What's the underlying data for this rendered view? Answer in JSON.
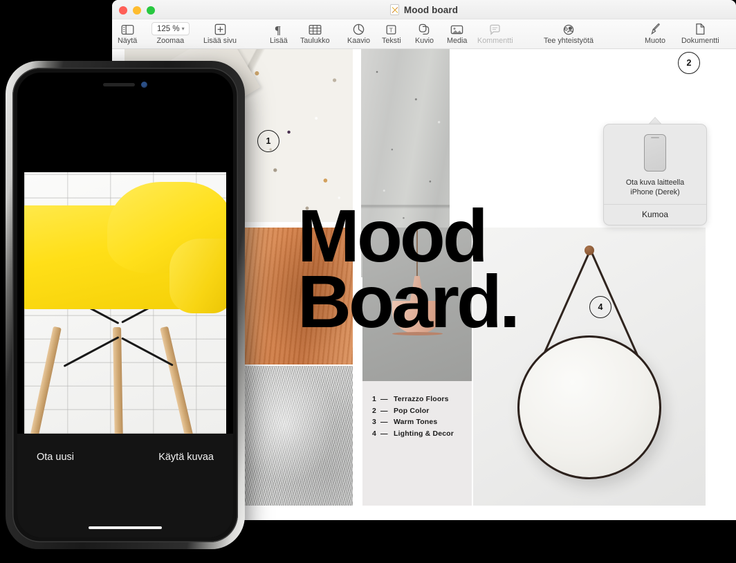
{
  "window": {
    "title": "Mood board",
    "document_icon": "keynote-document-icon",
    "traffic_lights": [
      "close-button",
      "minimize-button",
      "maximize-button"
    ]
  },
  "toolbar": {
    "items": [
      {
        "label": "Näytä",
        "icon": "sidebar-view-icon",
        "dimmed": false
      },
      {
        "label": "Zoomaa",
        "icon": "zoom-chevron-icon",
        "dimmed": false,
        "value": "125 %"
      },
      {
        "label": "Lisää sivu",
        "icon": "add-page-icon",
        "dimmed": false
      },
      {
        "label": "Lisää",
        "icon": "pilcrow-icon",
        "dimmed": false
      },
      {
        "label": "Taulukko",
        "icon": "table-icon",
        "dimmed": false
      },
      {
        "label": "Kaavio",
        "icon": "chart-pie-icon",
        "dimmed": false
      },
      {
        "label": "Teksti",
        "icon": "text-box-icon",
        "dimmed": false
      },
      {
        "label": "Kuvio",
        "icon": "shapes-icon",
        "dimmed": false
      },
      {
        "label": "Media",
        "icon": "media-photo-icon",
        "dimmed": false
      },
      {
        "label": "Kommentti",
        "icon": "comment-bubble-icon",
        "dimmed": true
      },
      {
        "label": "Tee yhteistyötä",
        "icon": "collaborate-icon",
        "dimmed": false
      },
      {
        "label": "Muoto",
        "icon": "format-brush-icon",
        "dimmed": false
      },
      {
        "label": "Dokumentti",
        "icon": "document-icon",
        "dimmed": false
      }
    ]
  },
  "popover": {
    "device_icon": "iphone-device-icon",
    "message_line1": "Ota kuva laitteella",
    "message_line2": "iPhone (Derek)",
    "cancel_label": "Kumoa"
  },
  "document": {
    "headline": "Mood\nBoard.",
    "callouts": [
      {
        "number": "1"
      },
      {
        "number": "2"
      },
      {
        "number": "4"
      }
    ],
    "legend": [
      {
        "num": "1",
        "dash": "—",
        "label": "Terrazzo Floors"
      },
      {
        "num": "2",
        "dash": "—",
        "label": "Pop Color"
      },
      {
        "num": "3",
        "dash": "—",
        "label": "Warm Tones"
      },
      {
        "num": "4",
        "dash": "—",
        "label": "Lighting & Decor"
      }
    ],
    "images": [
      {
        "name": "terrazzo-slab-photo"
      },
      {
        "name": "concrete-wall-photo"
      },
      {
        "name": "plaster-wall-with-tan-sofa-photo"
      },
      {
        "name": "wood-grain-photo"
      },
      {
        "name": "grey-fur-rug-photo"
      },
      {
        "name": "pink-pendant-lamp-photo"
      },
      {
        "name": "round-hanging-mirror-photo"
      }
    ]
  },
  "phone": {
    "camera_preview": "yellow-eames-chair-photo",
    "notch_items": [
      "earpiece-speaker",
      "front-camera"
    ],
    "actions": {
      "retake_label": "Ota uusi",
      "use_label": "Käytä kuvaa"
    }
  },
  "colors": {
    "accent_yellow": "#ffdf18",
    "close_red": "#ff5f57",
    "minimize_yellow": "#febc2e",
    "maximize_green": "#28c840",
    "popover_bg": "#e9e9e9",
    "canvas_bg": "#ffffff"
  }
}
